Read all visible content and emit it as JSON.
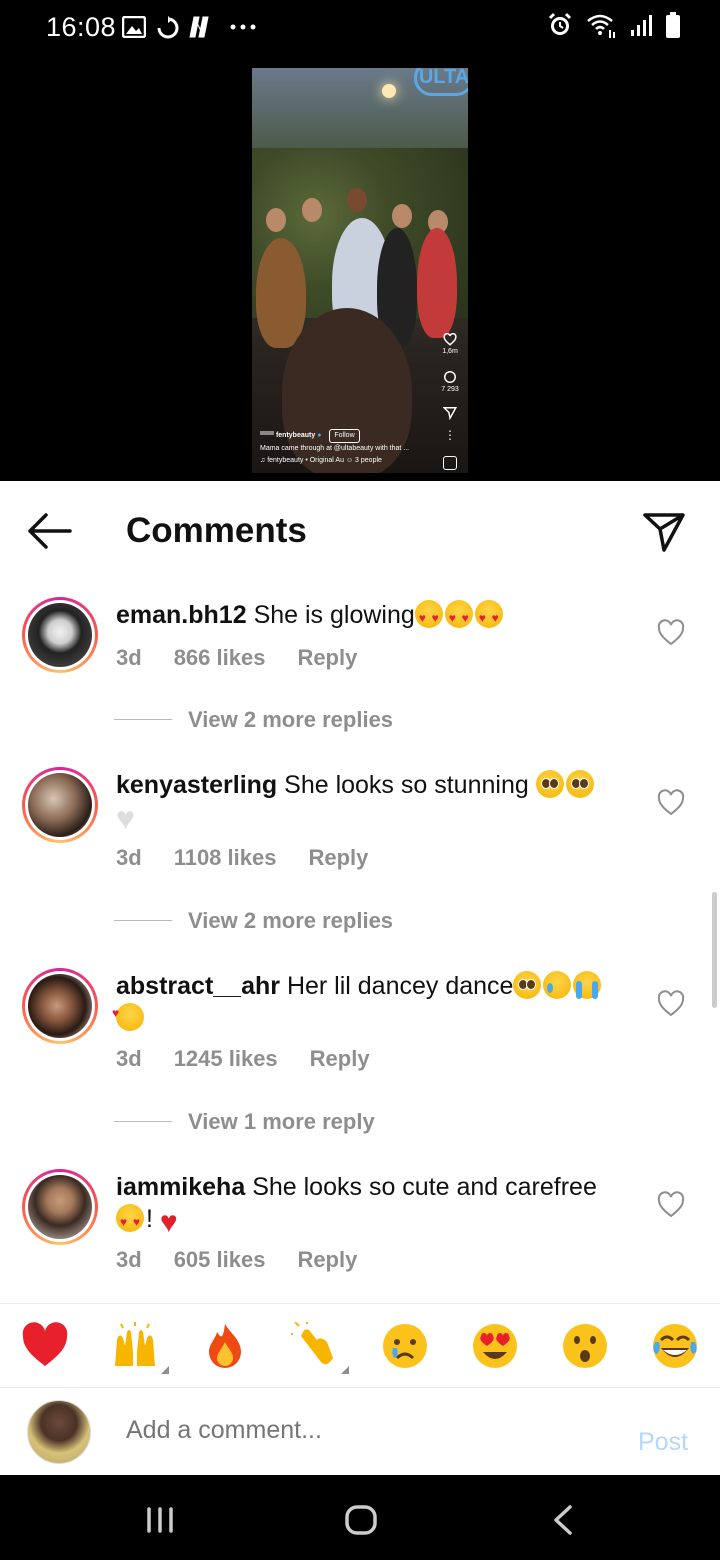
{
  "status_bar": {
    "time": "16:08"
  },
  "reel": {
    "logo": "ULTA",
    "likes": "1,6m",
    "comments": "7 293",
    "username": "fentybeauty",
    "follow": "Follow",
    "caption": "Mama came through at @ultabeauty with that ...",
    "audio": "fentybeauty • Original Au",
    "people": "3 people"
  },
  "header": {
    "title": "Comments"
  },
  "comments": [
    {
      "user": "eman.bh12",
      "text": "She is glowing",
      "time": "3d",
      "likes": "866 likes",
      "reply": "Reply",
      "replies": "View 2 more replies"
    },
    {
      "user": "kenyasterling",
      "text": "She looks so stunning ",
      "time": "3d",
      "likes": "1108 likes",
      "reply": "Reply",
      "replies": "View 2 more replies"
    },
    {
      "user": "abstract__ahr",
      "text": "Her lil dancey dance",
      "time": "3d",
      "likes": "1245 likes",
      "reply": "Reply",
      "replies": "View 1 more reply"
    },
    {
      "user": "iammikeha",
      "text": "She looks so cute and carefree",
      "excl": "!",
      "time": "3d",
      "likes": "605 likes",
      "reply": "Reply"
    }
  ],
  "add_comment": {
    "placeholder": "Add a comment...",
    "post": "Post"
  }
}
